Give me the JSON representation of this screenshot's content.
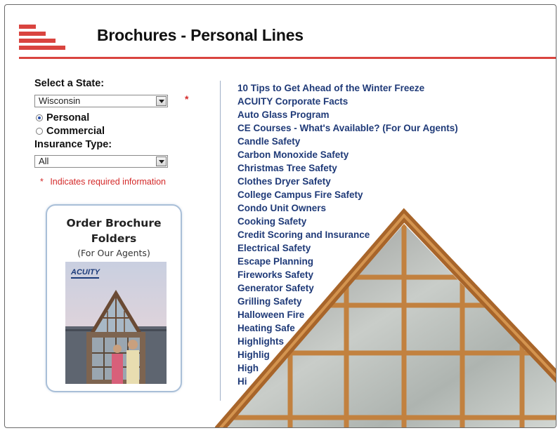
{
  "header": {
    "title": "Brochures - Personal Lines",
    "logo_icon": "red-stripes-logo-icon"
  },
  "sidebar": {
    "state_label": "Select a State:",
    "state_value": "Wisconsin",
    "required_marker": "*",
    "line_options": [
      {
        "label": "Personal",
        "selected": true
      },
      {
        "label": "Commercial",
        "selected": false
      }
    ],
    "insurance_type_label": "Insurance Type:",
    "insurance_type_value": "All",
    "required_note_star": "*",
    "required_note": "Indicates required information"
  },
  "promo": {
    "title_line1": "Order Brochure",
    "title_line2": "Folders",
    "subtitle": "(For Our Agents)",
    "cover_brand": "ACUITY"
  },
  "brochures": [
    "10 Tips to Get Ahead of the Winter Freeze",
    "ACUITY Corporate Facts",
    "Auto Glass Program",
    "CE Courses - What's Available? (For Our Agents)",
    "Candle Safety",
    "Carbon Monoxide Safety",
    "Christmas Tree Safety",
    "Clothes Dryer Safety",
    "College Campus Fire Safety",
    "Condo Unit Owners",
    "Cooking Safety",
    "Credit Scoring and Insurance",
    "Electrical Safety",
    "Escape Planning",
    "Fireworks Safety",
    "Generator Safety",
    "Grilling Safety",
    "Halloween Fire",
    "Heating Safe",
    "Highlights",
    "Highlig",
    "High",
    "Hi"
  ],
  "colors": {
    "accent_red": "#d9443f",
    "link_blue": "#1f3a78",
    "required_red": "#d42a2a",
    "frame_copper": "#b9722e"
  }
}
